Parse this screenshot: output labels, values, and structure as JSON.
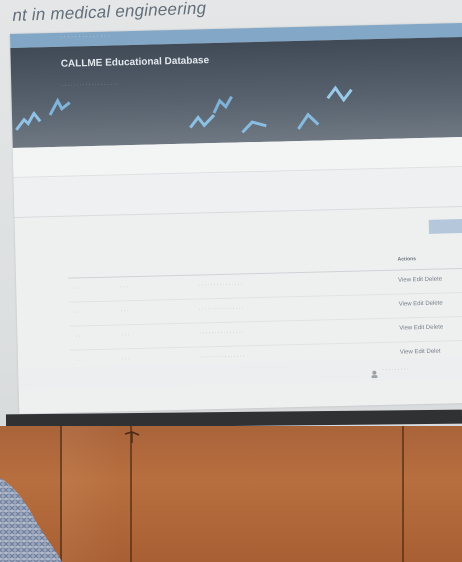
{
  "slide": {
    "heading": "nt in medical engineering"
  },
  "website": {
    "title": "CALLME Educational Database"
  },
  "table": {
    "headers": [
      "",
      "",
      "",
      "Actions"
    ],
    "rows": [
      {
        "actions": "View Edit Delete"
      },
      {
        "actions": "View Edit Delete"
      },
      {
        "actions": "View Edit Delete"
      },
      {
        "actions": "View Edit Delet"
      }
    ]
  },
  "colors": {
    "banner": "#4b5560",
    "topbar": "#5f8fb8",
    "wood": "#b46b3c"
  }
}
